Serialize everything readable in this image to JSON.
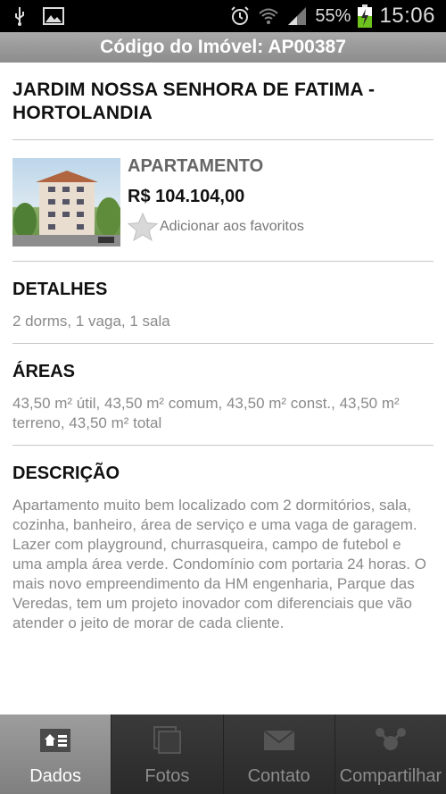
{
  "status_bar": {
    "battery": "55%",
    "time": "15:06"
  },
  "header": {
    "title": "Código do Imóvel: AP00387"
  },
  "property": {
    "title": "JARDIM NOSSA SENHORA DE FATIMA - HORTOLANDIA",
    "type": "APARTAMENTO",
    "price": "R$ 104.104,00",
    "favorite_label": "Adicionar aos favoritos"
  },
  "sections": {
    "details": {
      "heading": "DETALHES",
      "text": "2 dorms, 1 vaga, 1 sala"
    },
    "areas": {
      "heading": "ÁREAS",
      "text": "43,50 m² útil, 43,50 m² comum, 43,50 m² const., 43,50 m² terreno, 43,50 m² total"
    },
    "description": {
      "heading": "DESCRIÇÃO",
      "text": "Apartamento muito bem localizado com 2 dormitórios, sala, cozinha, banheiro, área de serviço e uma vaga de garagem. Lazer com playground, churrasqueira, campo de futebol e uma ampla área verde. Condomínio com portaria 24 horas. O mais novo empreendimento da HM engenharia, Parque das Veredas, tem um projeto inovador com diferenciais que vão atender o jeito de morar de cada cliente."
    }
  },
  "tabs": [
    {
      "label": "Dados",
      "icon": "home-card-icon",
      "active": true
    },
    {
      "label": "Fotos",
      "icon": "photos-icon",
      "active": false
    },
    {
      "label": "Contato",
      "icon": "envelope-icon",
      "active": false
    },
    {
      "label": "Compartilhar",
      "icon": "share-icon",
      "active": false
    }
  ],
  "colors": {
    "header_bg": "#999999",
    "tab_active_bg": "#8e8e8e",
    "tab_bg": "#2f2f2f"
  }
}
